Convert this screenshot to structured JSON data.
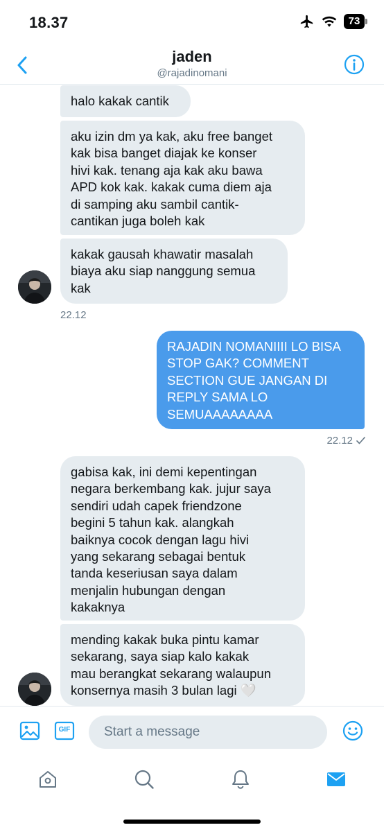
{
  "status_bar": {
    "time": "18.37",
    "battery": "73"
  },
  "header": {
    "name": "jaden",
    "handle": "@rajadinomani"
  },
  "messages": [
    {
      "text": "halo kakak cantik"
    },
    {
      "text": "aku izin dm ya kak, aku free banget\nkak bisa banget diajak ke konser\nhivi kak. tenang aja kak aku bawa\nAPD kok kak. kakak cuma diem aja\ndi samping aku sambil cantik-\ncantikan juga boleh kak"
    },
    {
      "text": "kakak gausah khawatir masalah\nbiaya aku siap nanggung semua\nkak"
    },
    {
      "text": "22.12"
    },
    {
      "text": "RAJADIN NOMANIIII LO BISA\nSTOP GAK? COMMENT\nSECTION GUE JANGAN DI\nREPLY SAMA LO\nSEMUAAAAAAAA"
    },
    {
      "text": "22.12"
    },
    {
      "text": "gabisa kak, ini demi kepentingan\nnegara berkembang kak. jujur saya\nsendiri udah capek friendzone\nbegini 5 tahun kak. alangkah\nbaiknya cocok dengan lagu hivi\nyang sekarang sebagai bentuk\ntanda keseriusan saya dalam\nmenjalin hubungan dengan\nkakaknya"
    },
    {
      "text": "mending kakak buka pintu kamar\nsekarang, saya siap kalo kakak\nmau berangkat sekarang walaupun\nkonsernya masih 3 bulan lagi 🤍"
    }
  ],
  "composer": {
    "placeholder": "Start a message",
    "gif_label": "GIF"
  },
  "icons": {
    "back": "chevron-left-icon",
    "info": "info-icon",
    "image": "image-icon",
    "gif": "gif-icon",
    "emoji": "emoji-icon",
    "home": "home-icon",
    "search": "search-icon",
    "notifications": "bell-icon",
    "messages": "mail-icon",
    "read_receipt": "check-icon"
  },
  "colors": {
    "accent": "#1da1f2",
    "outgoing_bubble": "#4a9beb",
    "incoming_bubble": "#e6ecf0",
    "muted": "#657786"
  }
}
